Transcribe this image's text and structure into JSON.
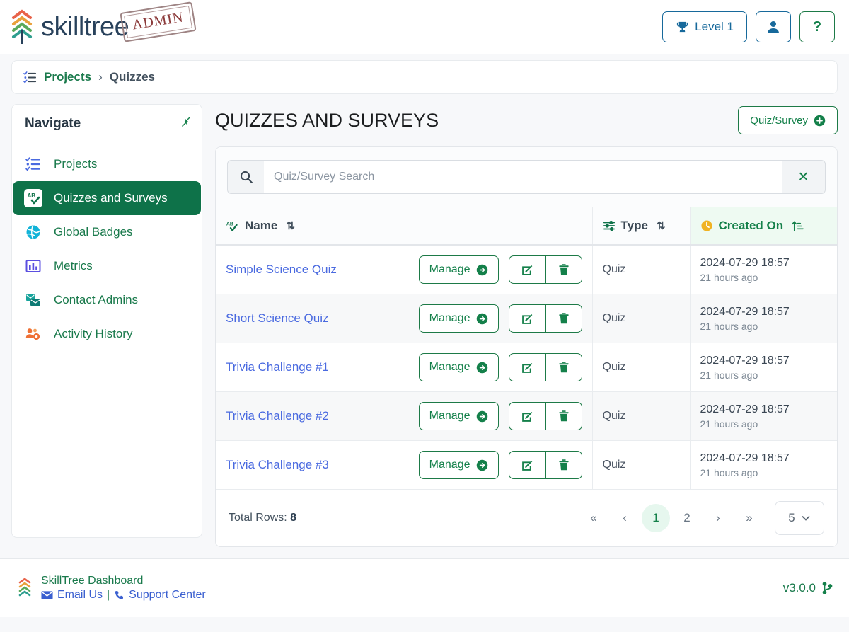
{
  "header": {
    "brand": "skilltree",
    "stamp": "ADMIN",
    "level_label": "Level 1",
    "level_icon": "trophy-icon",
    "user_icon": "user-icon",
    "help_label": "?"
  },
  "breadcrumb": {
    "icon": "tasks-list-icon",
    "root": "Projects",
    "separator": "›",
    "current": "Quizzes"
  },
  "sidebar": {
    "title": "Navigate",
    "collapse_icon": "compress-arrows-icon",
    "items": [
      {
        "label": "Projects",
        "icon": "tasks-list-icon",
        "active": false
      },
      {
        "label": "Quizzes and Surveys",
        "icon": "ab-check-icon",
        "active": true
      },
      {
        "label": "Global Badges",
        "icon": "globe-icon",
        "active": false
      },
      {
        "label": "Metrics",
        "icon": "chart-bar-icon",
        "active": false
      },
      {
        "label": "Contact Admins",
        "icon": "mail-bulk-icon",
        "active": false
      },
      {
        "label": "Activity History",
        "icon": "users-cog-icon",
        "active": false
      }
    ]
  },
  "main": {
    "page_title": "QUIZZES AND SURVEYS",
    "new_button": {
      "label": "Quiz/Survey",
      "icon": "plus-circle-icon"
    },
    "search": {
      "icon": "search-icon",
      "placeholder": "Quiz/Survey Search",
      "value": "",
      "clear_icon": "times-icon"
    },
    "table": {
      "columns": [
        {
          "label": "Name",
          "icon": "ab-check-icon",
          "sort_icon": "sort-icon",
          "sorted": false
        },
        {
          "label": "Type",
          "icon": "sliders-icon",
          "sort_icon": "sort-icon",
          "sorted": false
        },
        {
          "label": "Created On",
          "icon": "clock-icon",
          "sort_icon": "sort-amount-up-icon",
          "sorted": true
        }
      ],
      "row_actions": {
        "manage_label": "Manage",
        "manage_icon": "arrow-circle-right-icon",
        "edit_icon": "edit-pencil-icon",
        "delete_icon": "trash-icon"
      },
      "rows": [
        {
          "name": "Simple Science Quiz",
          "type": "Quiz",
          "created_on": "2024-07-29 18:57",
          "created_relative": "21 hours ago"
        },
        {
          "name": "Short Science Quiz",
          "type": "Quiz",
          "created_on": "2024-07-29 18:57",
          "created_relative": "21 hours ago"
        },
        {
          "name": "Trivia Challenge #1",
          "type": "Quiz",
          "created_on": "2024-07-29 18:57",
          "created_relative": "21 hours ago"
        },
        {
          "name": "Trivia Challenge #2",
          "type": "Quiz",
          "created_on": "2024-07-29 18:57",
          "created_relative": "21 hours ago"
        },
        {
          "name": "Trivia Challenge #3",
          "type": "Quiz",
          "created_on": "2024-07-29 18:57",
          "created_relative": "21 hours ago"
        }
      ]
    },
    "pagination": {
      "total_rows_label": "Total Rows:",
      "total_rows": "8",
      "first": "«",
      "prev": "‹",
      "pages": [
        "1",
        "2"
      ],
      "active_page": "1",
      "next": "›",
      "last": "»",
      "page_size": "5",
      "page_size_icon": "chevron-down-icon"
    }
  },
  "footer": {
    "logo_icon": "skilltree-chevrons-icon",
    "title": "SkillTree Dashboard",
    "email_link": "Email Us",
    "email_icon": "envelope-icon",
    "divider": "|",
    "support_link": "Support Center",
    "support_icon": "phone-icon",
    "version": "v3.0.0",
    "version_icon": "code-branch-icon"
  },
  "colors": {
    "brand_green": "#14804a",
    "active_nav": "#0e7249",
    "link_blue": "#4a6ae0",
    "header_blue": "#17699b"
  }
}
